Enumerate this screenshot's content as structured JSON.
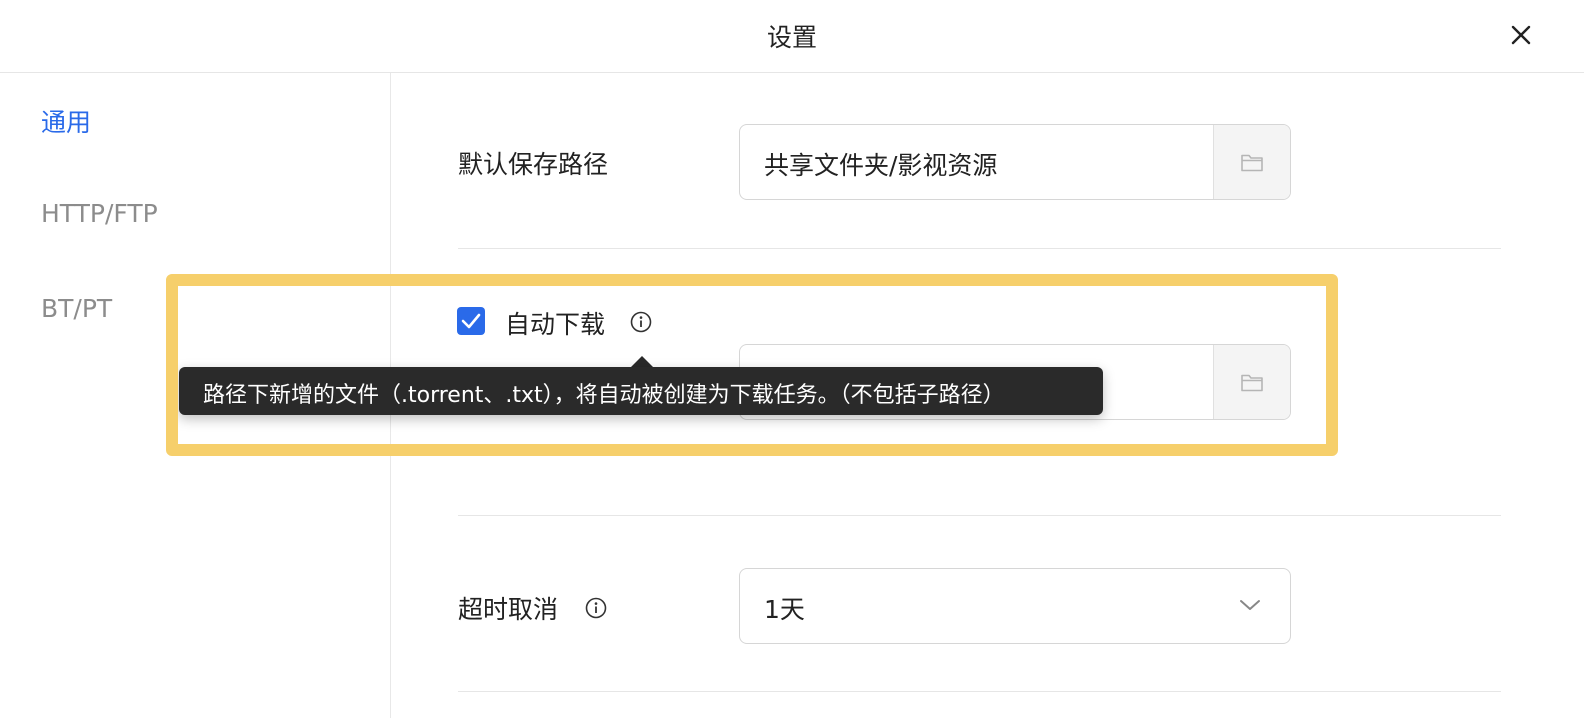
{
  "header": {
    "title": "设置",
    "close_icon": "close-icon"
  },
  "sidebar": {
    "items": [
      {
        "label": "通用",
        "active": true
      },
      {
        "label": "HTTP/FTP",
        "active": false
      },
      {
        "label": "BT/PT",
        "active": false
      }
    ]
  },
  "general": {
    "default_path_label": "默认保存路径",
    "default_path_value": "共享文件夹/影视资源",
    "auto_download_label": "自动下载",
    "auto_download_checked": true,
    "auto_download_path_value": "",
    "tooltip_text": "路径下新增的文件（.torrent、.txt），将自动被创建为下载任务。（不包括子路径）",
    "timeout_label": "超时取消",
    "timeout_value": "1天"
  },
  "colors": {
    "accent": "#2a6ae9",
    "highlight": "#f6cf6b",
    "tooltip_bg": "#2a2a2a"
  }
}
